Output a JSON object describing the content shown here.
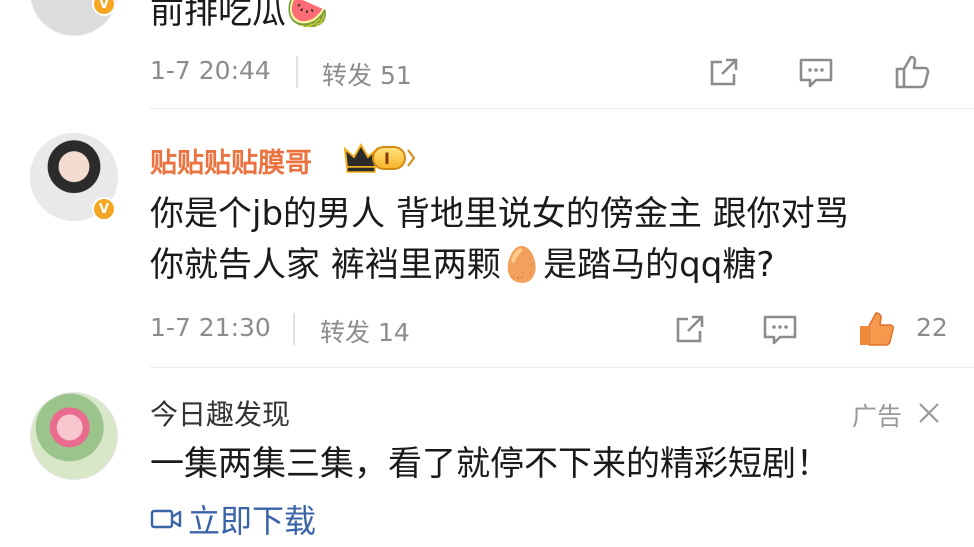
{
  "comment1": {
    "text": "前排吃瓜",
    "emoji": "🍉",
    "time": "1-7 20:44",
    "repost_label": "转发 51"
  },
  "comment2": {
    "username": "贴贴贴贴膜哥",
    "level": "I",
    "line1": "你是个jb的男人  背地里说女的傍金主  跟你对骂",
    "line2a": "你就告人家  裤裆里两颗",
    "emoji": "🥚",
    "line2b": "是踏马的qq糖?",
    "time": "1-7 21:30",
    "repost_label": "转发 14",
    "like_count": "22"
  },
  "ad": {
    "name": "今日趣发现",
    "label": "广告",
    "close": "✕",
    "text": "一集两集三集，看了就停不下来的精彩短剧！",
    "link": "立即下载"
  },
  "colors": {
    "username": "#eb7340",
    "like_active": "#f08a3a",
    "link": "#3b64a8",
    "meta": "#8c8c8c"
  },
  "icons": [
    "share-icon",
    "comment-icon",
    "like-icon",
    "like-active-icon",
    "video-icon",
    "close-icon"
  ]
}
